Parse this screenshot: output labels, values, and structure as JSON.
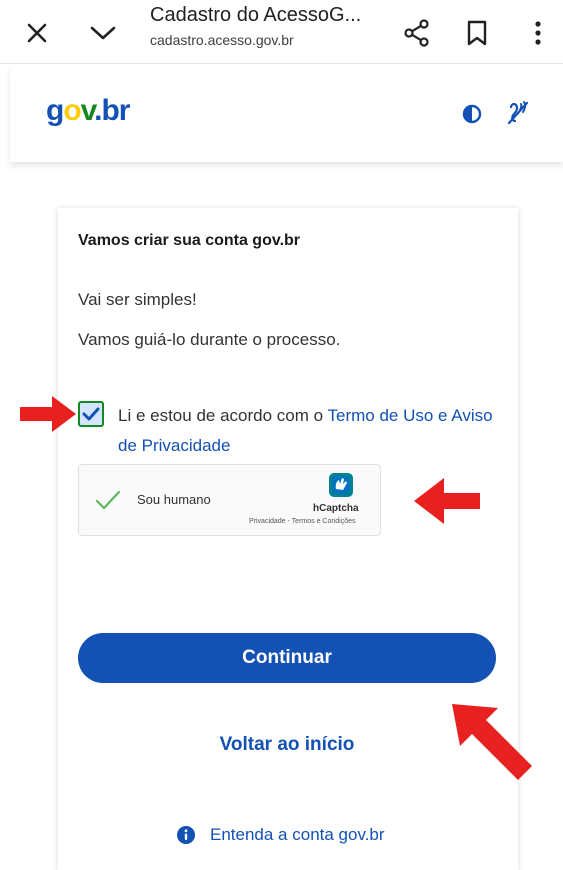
{
  "browser": {
    "tab_title": "Cadastro do AcessoG...",
    "url": "cadastro.acesso.gov.br",
    "icons": [
      "close-icon",
      "chevron-down-icon",
      "share-icon",
      "bookmark-icon",
      "more-vert-icon"
    ]
  },
  "header": {
    "logo_g": "g",
    "logo_o": "o",
    "logo_v": "v",
    "logo_dot": ".",
    "logo_br": "br",
    "icons": [
      "contrast-icon",
      "accessibility-icon"
    ]
  },
  "card": {
    "heading": "Vamos criar sua conta gov.br",
    "paragraph_1": "Vai ser simples!",
    "paragraph_2": "Vamos guiá-lo durante o processo.",
    "terms_prefix": "Li e estou de acordo com o ",
    "terms_link": "Termo de Uso e Aviso de Privacidade",
    "terms_checked": true,
    "captcha": {
      "label": "Sou humano",
      "brand": "hCaptcha",
      "terms": "Privacidade - Termos e Condições",
      "verified": true
    },
    "continue_label": "Continuar",
    "back_label": "Voltar ao início",
    "info_label": "Entenda a conta gov.br"
  },
  "colors": {
    "primary": "#1351b4",
    "success_green": "#168821",
    "logo_yellow": "#ffcd07",
    "annotation_red": "#e8201f"
  }
}
